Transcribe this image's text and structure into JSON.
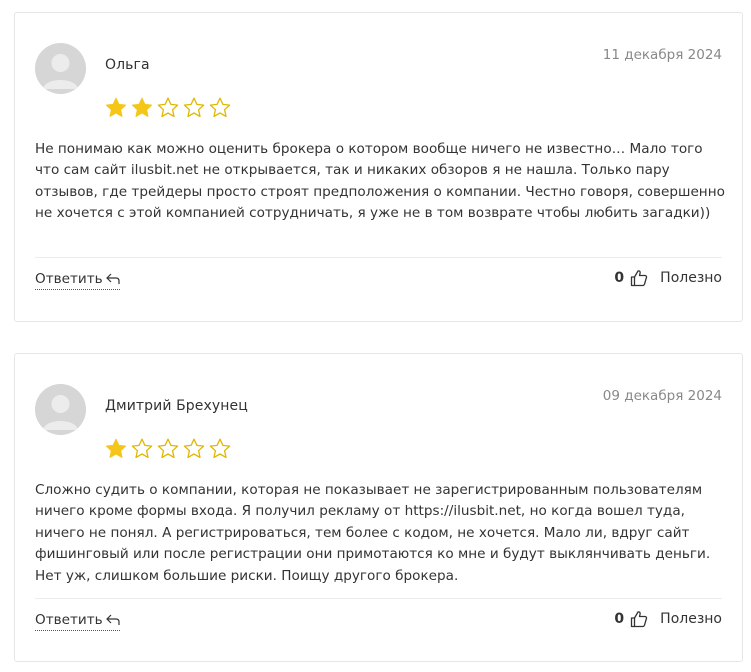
{
  "colors": {
    "star_filled": "#f5c518",
    "star_empty_outline": "#e0b800",
    "avatar_bg": "#dcdcdc",
    "card_border": "#e6e6e6",
    "date_text": "#888888"
  },
  "reviews": [
    {
      "author": "Ольга",
      "date": "11 декабря 2024",
      "rating": 2,
      "rating_max": 5,
      "text": "Не понимаю как можно оценить брокера о котором вообще ничего не известно… Мало того что сам сайт ilusbit.net не открывается, так и никаких обзоров я не нашла. Только пару отзывов, где трейдеры просто строят предположения о компании. Честно говоря, совершенно не хочется с этой компанией сотрудничать, я уже не в том возврате чтобы любить загадки))",
      "reply_label": "Ответить",
      "likes": "0",
      "helpful_label": "Полезно",
      "icons": [
        "avatar-placeholder-icon",
        "reply-arrow-icon",
        "thumbs-up-icon"
      ]
    },
    {
      "author": "Дмитрий Брехунец",
      "date": "09 декабря 2024",
      "rating": 1,
      "rating_max": 5,
      "text": "Сложно судить о компании, которая не показывает не зарегистрированным пользователям ничего кроме формы входа. Я получил рекламу от https://ilusbit.net, но когда вошел туда, ничего не понял. А регистрироваться, тем более с кодом, не хочется. Мало ли, вдруг сайт фишинговый или после регистрации они примотаются ко мне и будут выклянчивать деньги. Нет уж, слишком большие риски. Поищу другого брокера.",
      "reply_label": "Ответить",
      "likes": "0",
      "helpful_label": "Полезно",
      "icons": [
        "avatar-placeholder-icon",
        "reply-arrow-icon",
        "thumbs-up-icon"
      ]
    }
  ]
}
